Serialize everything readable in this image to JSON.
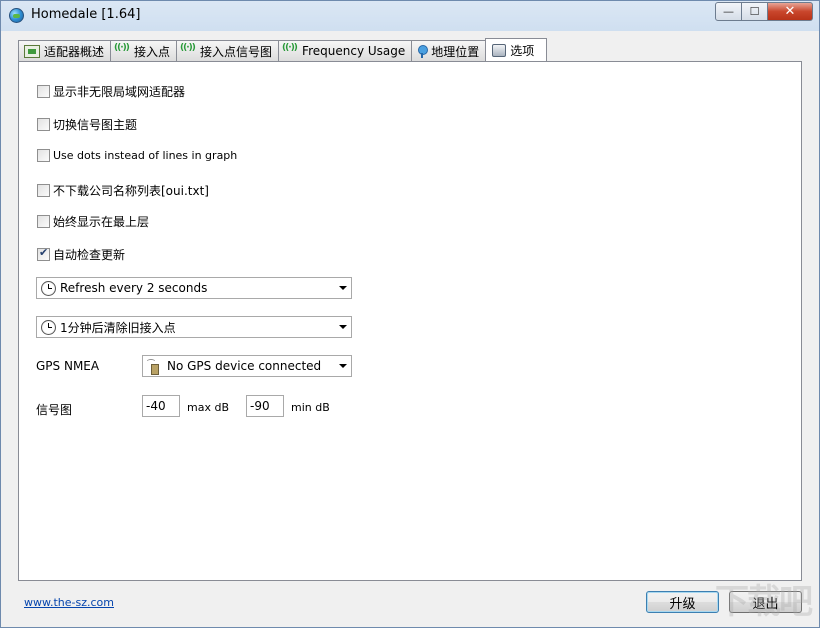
{
  "window": {
    "title": "Homedale [1.64]",
    "min_glyph": "—",
    "max_glyph": "☐",
    "close_glyph": "✕"
  },
  "tabs": [
    {
      "label": "适配器概述",
      "icon": "adapter-icon"
    },
    {
      "label": "接入点",
      "icon": "wifi-icon"
    },
    {
      "label": "接入点信号图",
      "icon": "wifi-icon"
    },
    {
      "label": "Frequency Usage",
      "icon": "wifi-icon"
    },
    {
      "label": "地理位置",
      "icon": "pin-icon"
    },
    {
      "label": "选项",
      "icon": "options-icon",
      "active": true
    }
  ],
  "options": {
    "checkboxes": [
      {
        "label": "显示非无限局域网适配器",
        "checked": false
      },
      {
        "label": "切换信号图主题",
        "checked": false
      },
      {
        "label": "Use dots instead of lines in graph",
        "checked": false
      },
      {
        "label": "不下载公司名称列表[oui.txt]",
        "checked": false
      },
      {
        "label": "始终显示在最上层",
        "checked": false
      },
      {
        "label": "自动检查更新",
        "checked": true
      }
    ],
    "refresh_select": "Refresh every 2 seconds",
    "clear_select": "1分钟后清除旧接入点",
    "gps_label": "GPS NMEA",
    "gps_select": "No GPS device connected",
    "signal_label": "信号图",
    "max_value": "-40",
    "max_unit": "max dB",
    "min_value": "-90",
    "min_unit": "min dB"
  },
  "footer": {
    "link": "www.the-sz.com",
    "upgrade_button": "升级",
    "exit_button": "退出",
    "watermark": "下载吧"
  }
}
